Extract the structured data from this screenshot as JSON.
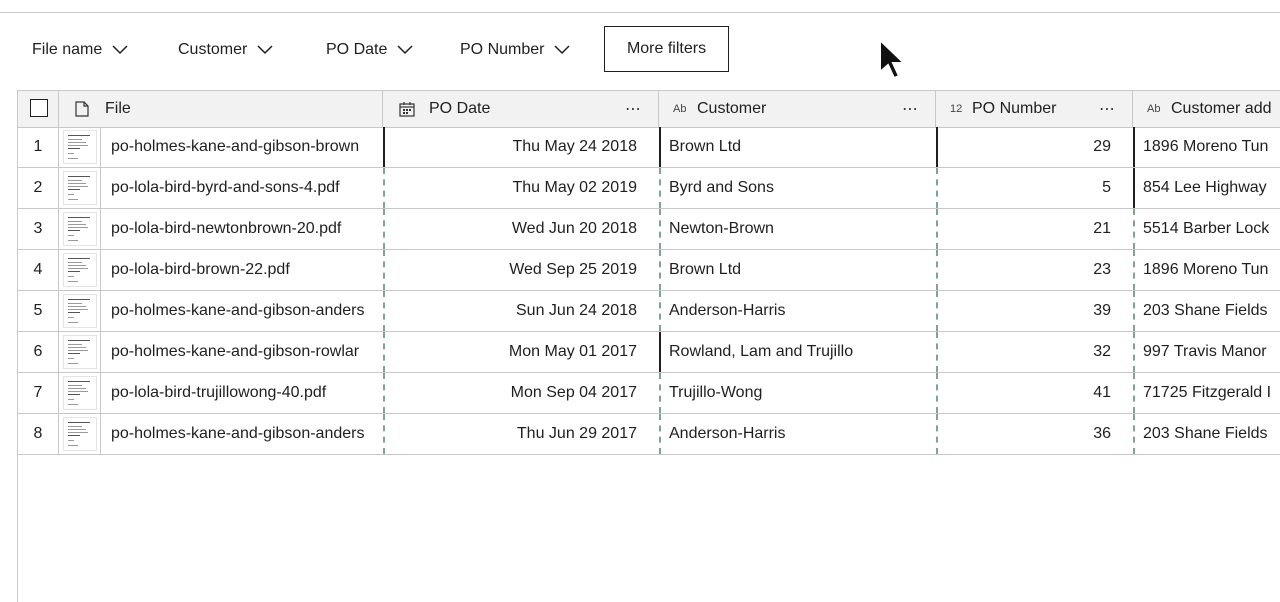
{
  "filters": [
    {
      "label": "File name"
    },
    {
      "label": "Customer"
    },
    {
      "label": "PO Date"
    },
    {
      "label": "PO Number"
    }
  ],
  "more_filters_label": "More filters",
  "columns": {
    "file": {
      "label": "File",
      "icon": "file-icon"
    },
    "po_date": {
      "label": "PO Date",
      "icon": "calendar-icon"
    },
    "customer": {
      "label": "Customer",
      "type_badge": "Ab"
    },
    "po_number": {
      "label": "PO Number",
      "type_badge": "12"
    },
    "customer_address": {
      "label": "Customer add",
      "type_badge": "Ab"
    }
  },
  "rows": [
    {
      "index": "1",
      "file": "po-holmes-kane-and-gibson-brown",
      "po_date": "Thu May 24 2018",
      "customer": "Brown Ltd",
      "po_number": "29",
      "address": "1896 Moreno Tun"
    },
    {
      "index": "2",
      "file": "po-lola-bird-byrd-and-sons-4.pdf",
      "po_date": "Thu May 02 2019",
      "customer": "Byrd and Sons",
      "po_number": "5",
      "address": "854 Lee Highway"
    },
    {
      "index": "3",
      "file": "po-lola-bird-newtonbrown-20.pdf",
      "po_date": "Wed Jun 20 2018",
      "customer": "Newton-Brown",
      "po_number": "21",
      "address": "5514 Barber Lock"
    },
    {
      "index": "4",
      "file": "po-lola-bird-brown-22.pdf",
      "po_date": "Wed Sep 25 2019",
      "customer": "Brown Ltd",
      "po_number": "23",
      "address": "1896 Moreno Tun"
    },
    {
      "index": "5",
      "file": "po-holmes-kane-and-gibson-anders",
      "po_date": "Sun Jun 24 2018",
      "customer": "Anderson-Harris",
      "po_number": "39",
      "address": "203 Shane Fields"
    },
    {
      "index": "6",
      "file": "po-holmes-kane-and-gibson-rowlar",
      "po_date": "Mon May 01 2017",
      "customer": "Rowland, Lam and Trujillo",
      "po_number": "32",
      "address": "997 Travis Manor"
    },
    {
      "index": "7",
      "file": "po-lola-bird-trujillowong-40.pdf",
      "po_date": "Mon Sep 04 2017",
      "customer": "Trujillo-Wong",
      "po_number": "41",
      "address": "71725 Fitzgerald I"
    },
    {
      "index": "8",
      "file": "po-holmes-kane-and-gibson-anders",
      "po_date": "Thu Jun 29 2017",
      "customer": "Anderson-Harris",
      "po_number": "36",
      "address": "203 Shane Fields"
    }
  ]
}
